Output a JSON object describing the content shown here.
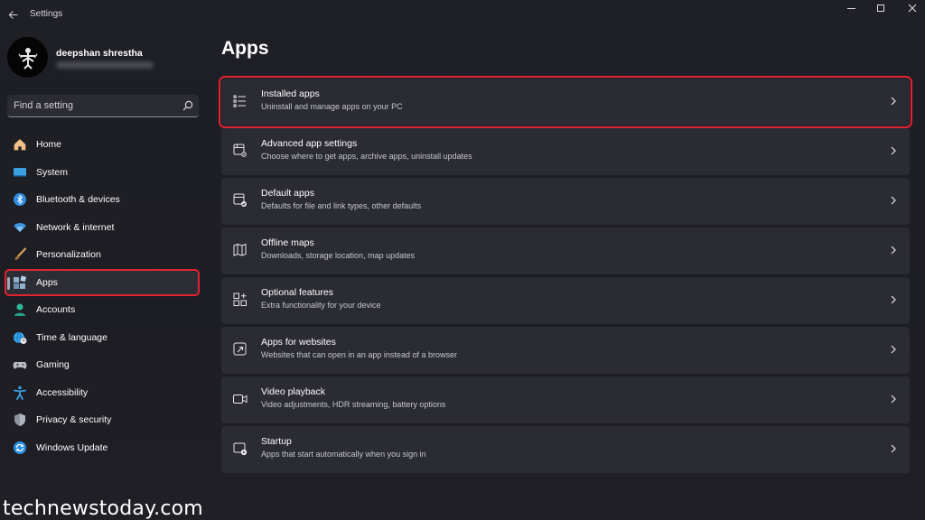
{
  "window": {
    "title": "Settings"
  },
  "profile": {
    "name": "deepshan shrestha"
  },
  "search": {
    "placeholder": "Find a setting"
  },
  "nav": {
    "items": [
      {
        "label": "Home",
        "icon": "home-icon"
      },
      {
        "label": "System",
        "icon": "monitor-icon"
      },
      {
        "label": "Bluetooth & devices",
        "icon": "bluetooth-icon"
      },
      {
        "label": "Network & internet",
        "icon": "wifi-icon"
      },
      {
        "label": "Personalization",
        "icon": "brush-icon"
      },
      {
        "label": "Apps",
        "icon": "apps-icon",
        "selected": true
      },
      {
        "label": "Accounts",
        "icon": "person-icon"
      },
      {
        "label": "Time & language",
        "icon": "globe-clock-icon"
      },
      {
        "label": "Gaming",
        "icon": "gamepad-icon"
      },
      {
        "label": "Accessibility",
        "icon": "accessibility-icon"
      },
      {
        "label": "Privacy & security",
        "icon": "shield-icon"
      },
      {
        "label": "Windows Update",
        "icon": "update-icon"
      }
    ]
  },
  "main": {
    "title": "Apps",
    "cards": [
      {
        "title": "Installed apps",
        "subtitle": "Uninstall and manage apps on your PC",
        "icon": "list-icon",
        "highlighted": true
      },
      {
        "title": "Advanced app settings",
        "subtitle": "Choose where to get apps, archive apps, uninstall updates",
        "icon": "app-gear-icon"
      },
      {
        "title": "Default apps",
        "subtitle": "Defaults for file and link types, other defaults",
        "icon": "app-check-icon"
      },
      {
        "title": "Offline maps",
        "subtitle": "Downloads, storage location, map updates",
        "icon": "map-icon"
      },
      {
        "title": "Optional features",
        "subtitle": "Extra functionality for your device",
        "icon": "grid-add-icon"
      },
      {
        "title": "Apps for websites",
        "subtitle": "Websites that can open in an app instead of a browser",
        "icon": "open-link-icon"
      },
      {
        "title": "Video playback",
        "subtitle": "Video adjustments, HDR streaming, battery options",
        "icon": "video-icon"
      },
      {
        "title": "Startup",
        "subtitle": "Apps that start automatically when you sign in",
        "icon": "startup-icon"
      }
    ]
  },
  "watermark": "technewstoday.com",
  "colors": {
    "accent_highlight": "#e0232e",
    "card_bg": "#2b2b33",
    "window_bg": "#1f1f26"
  }
}
